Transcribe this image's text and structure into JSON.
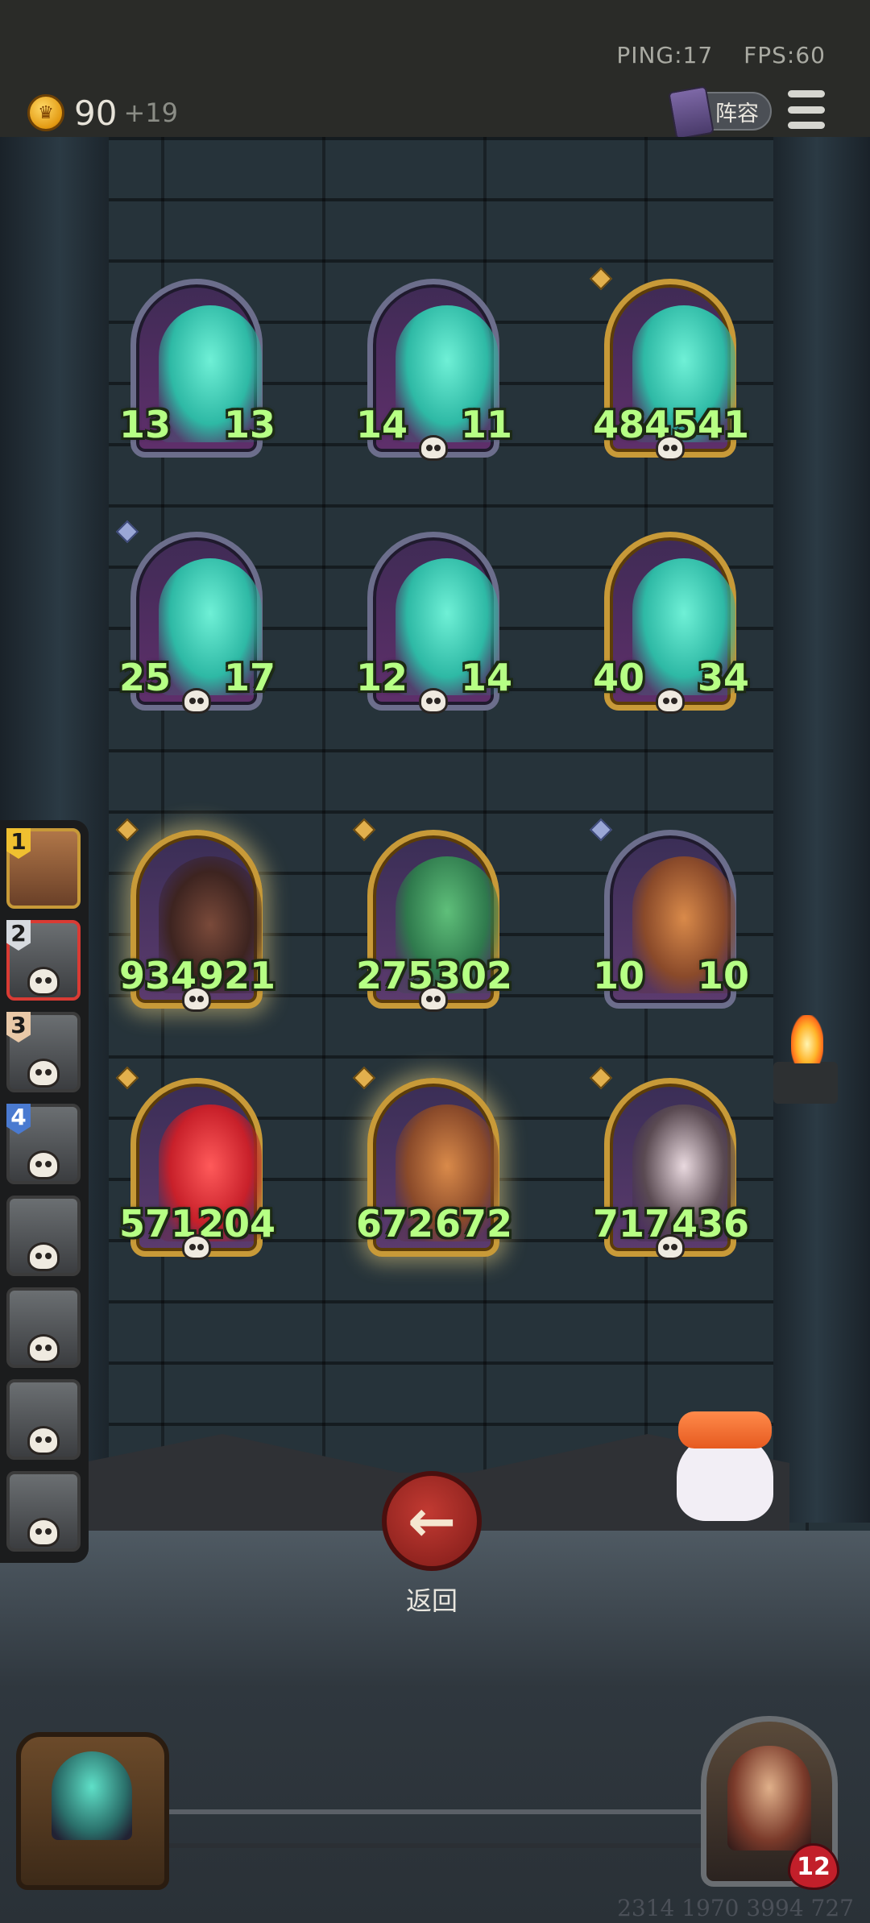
{
  "topbar": {
    "ping": "PING:17",
    "fps": "FPS:60",
    "gold": "90",
    "gold_income": "+19",
    "team_button": "阵容"
  },
  "board": {
    "rows": [
      [
        {
          "atk": "13",
          "hp": "13",
          "style": "ghost",
          "frame": "silver",
          "skull": false,
          "diamond": ""
        },
        {
          "atk": "14",
          "hp": "11",
          "style": "ghost",
          "frame": "silver",
          "skull": true,
          "diamond": ""
        },
        {
          "atk": "484",
          "hp": "541",
          "style": "ghost",
          "frame": "gold",
          "skull": true,
          "diamond": "gold"
        }
      ],
      [
        {
          "atk": "25",
          "hp": "17",
          "style": "ghost",
          "frame": "silver",
          "skull": true,
          "diamond": "blue"
        },
        {
          "atk": "12",
          "hp": "14",
          "style": "ghost",
          "frame": "silver",
          "skull": true,
          "diamond": ""
        },
        {
          "atk": "40",
          "hp": "34",
          "style": "ghost",
          "frame": "gold",
          "skull": true,
          "diamond": ""
        }
      ],
      [
        {
          "atk": "934",
          "hp": "921",
          "style": "boar",
          "frame": "gold",
          "skull": true,
          "diamond": "gold"
        },
        {
          "atk": "275",
          "hp": "302",
          "style": "bird",
          "frame": "gold",
          "skull": true,
          "diamond": "gold"
        },
        {
          "atk": "10",
          "hp": "10",
          "style": "color",
          "frame": "silver",
          "skull": false,
          "diamond": "blue"
        }
      ],
      [
        {
          "atk": "571",
          "hp": "204",
          "style": "red",
          "frame": "gold",
          "skull": true,
          "diamond": "gold"
        },
        {
          "atk": "672",
          "hp": "672",
          "style": "color",
          "frame": "gold",
          "skull": false,
          "diamond": "gold"
        },
        {
          "atk": "717",
          "hp": "436",
          "style": "bunny",
          "frame": "gold",
          "skull": true,
          "diamond": "gold"
        }
      ]
    ]
  },
  "sidebar": {
    "slots": [
      "1",
      "2",
      "3",
      "4",
      "",
      "",
      "",
      ""
    ]
  },
  "back": {
    "label": "返回",
    "icon": "arrow-left-icon"
  },
  "hero": {
    "health": "12"
  },
  "footer": {
    "uid": "2314 1970 3994 727"
  }
}
